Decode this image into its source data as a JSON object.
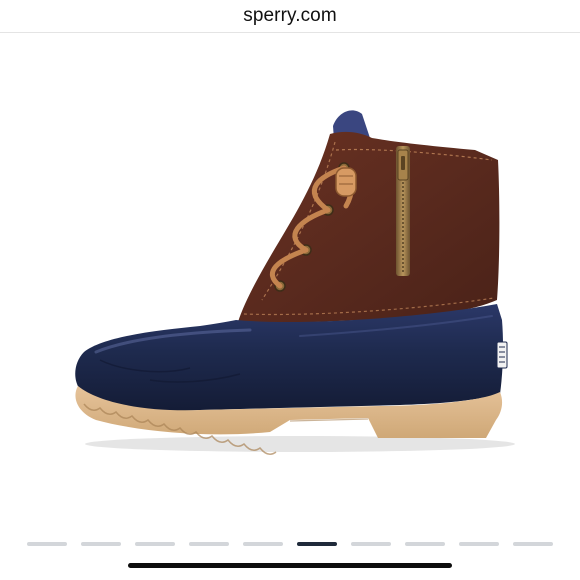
{
  "browser": {
    "address": "sperry.com"
  },
  "product_image": {
    "subject": "boot-photo",
    "colors": {
      "upper_leather": "#5a2a1e",
      "lower_rubber": "#1e2a4e",
      "sole": "#d9b487",
      "hardware": "#8a6a3a"
    }
  },
  "carousel": {
    "total_slides": 10,
    "active_index": 5,
    "inactive_color": "#d3d6da",
    "active_color": "#1f2a3a"
  },
  "system": {
    "home_indicator_color": "#0d0d0d"
  }
}
